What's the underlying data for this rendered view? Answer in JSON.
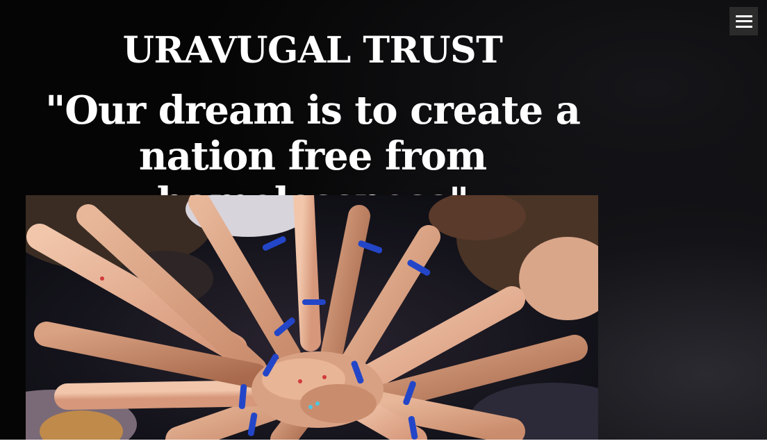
{
  "header": {
    "menu_icon": "hamburger-menu-icon"
  },
  "hero": {
    "title": "URAVUGAL TRUST",
    "tagline": "\"Our dream is to create a nation free from homelessness\""
  },
  "photo": {
    "description_icon": "hands-together-photo"
  },
  "colors": {
    "background": "#050505",
    "text": "#ffffff",
    "menu_button": "#2b2b2b",
    "wristband": "#2346c8"
  }
}
